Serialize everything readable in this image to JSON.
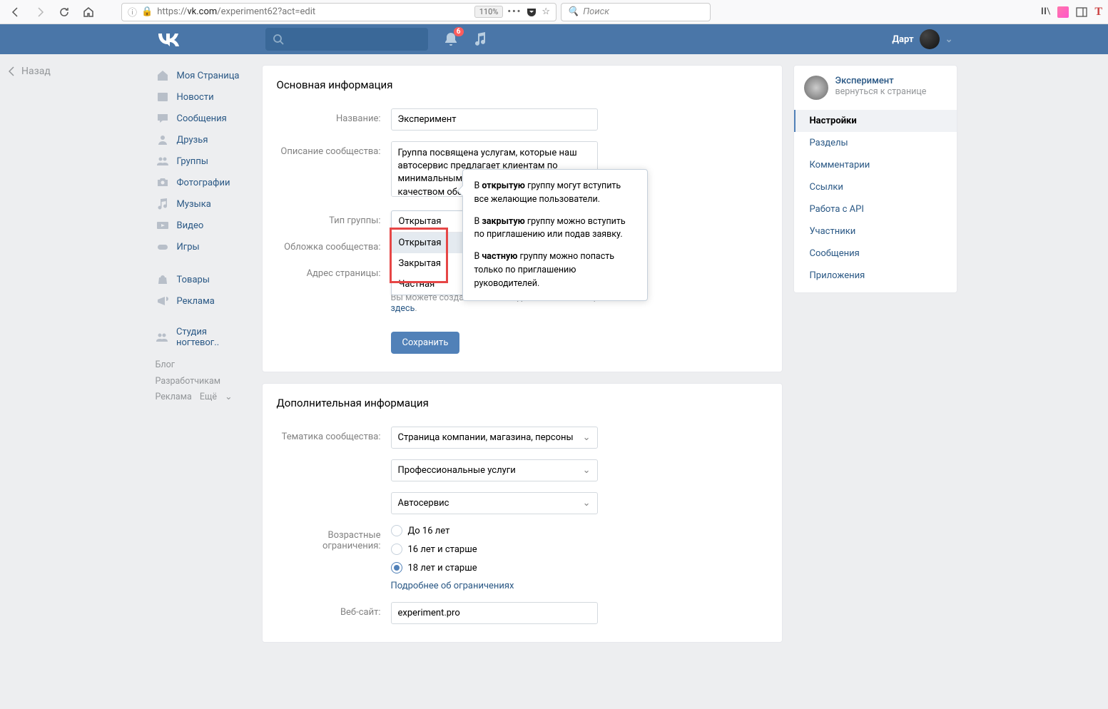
{
  "browser": {
    "url_host": "vk.com",
    "url_path": "/experiment62?act=edit",
    "url_proto": "https://",
    "zoom": "110%",
    "search_placeholder": "Поиск"
  },
  "header": {
    "notif_count": "6",
    "user_name": "Дарт"
  },
  "back_label": "Назад",
  "left_nav": {
    "items": [
      "Моя Страница",
      "Новости",
      "Сообщения",
      "Друзья",
      "Группы",
      "Фотографии",
      "Музыка",
      "Видео",
      "Игры",
      "Товары",
      "Реклама",
      "Студия ногтевог.."
    ],
    "footer": [
      "Блог",
      "Разработчикам",
      "Реклама",
      "Ещё"
    ]
  },
  "main": {
    "section1_title": "Основная информация",
    "name_label": "Название:",
    "name_value": "Эксперимент",
    "desc_label": "Описание сообщества:",
    "desc_value": "Группа посвящена услугам, которые наш автосервис предлагает клиентам по минимальным ценам и с высоким качеством обслуживания.",
    "type_label": "Тип группы:",
    "type_selected": "Открытая",
    "type_options": [
      "Открытая",
      "Закрытая",
      "Частная"
    ],
    "cover_label": "Обложка сообщества:",
    "addr_label": "Адрес страницы:",
    "sticker_hint_1": "Вы можете создать наклейки для Вашего сообщества ",
    "sticker_hint_link": "здесь",
    "save_btn": "Сохранить",
    "section2_title": "Дополнительная информация",
    "topic_label": "Тематика сообщества:",
    "topic1": "Страница компании, магазина, персоны",
    "topic2": "Профессиональные  услуги",
    "topic3": "Автосервис",
    "age_label": "Возрастные ограничения:",
    "age_opt1": "До 16 лет",
    "age_opt2": "16 лет и старше",
    "age_opt3": "18 лет и старше",
    "age_link": "Подробнее об ограничениях",
    "site_label": "Веб-сайт:",
    "site_value": "experiment.pro"
  },
  "tooltip": {
    "p1a": "В ",
    "p1b": "открытую",
    "p1c": " группу могут вступить все желающие пользователи.",
    "p2a": "В ",
    "p2b": "закрытую",
    "p2c": " группу можно вступить по приглашению или подав заявку.",
    "p3a": "В ",
    "p3b": "частную",
    "p3c": " группу можно попасть только по приглашению руководителей."
  },
  "side": {
    "comm_name": "Эксперимент",
    "comm_back": "вернуться к странице",
    "tabs": [
      "Настройки",
      "Разделы",
      "Комментарии",
      "Ссылки",
      "Работа с API",
      "Участники",
      "Сообщения",
      "Приложения"
    ]
  }
}
